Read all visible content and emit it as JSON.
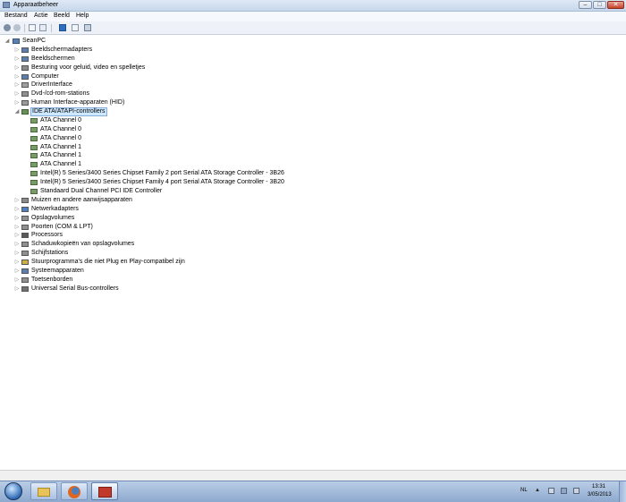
{
  "window": {
    "title": "Apparaatbeheer",
    "minimize": "–",
    "maximize": "□",
    "close": "✕"
  },
  "menu": [
    "Bestand",
    "Actie",
    "Beeld",
    "Help"
  ],
  "toolbar": {
    "icons": [
      "back-icon",
      "forward-icon",
      "properties-icon",
      "show-hide-tree-icon",
      "help-icon",
      "view-icon",
      "scan-hardware-icon"
    ]
  },
  "tree": {
    "root": "SeanPC",
    "categories_before": [
      {
        "label": "Beeldschermadapters",
        "icon": "display-adapter-icon",
        "color": "#5a7fb0"
      },
      {
        "label": "Beeldschermen",
        "icon": "monitor-icon",
        "color": "#5a7fb0"
      },
      {
        "label": "Besturing voor geluid, video en spelletjes",
        "icon": "speaker-icon",
        "color": "#8a8a8a"
      },
      {
        "label": "Computer",
        "icon": "computer-icon",
        "color": "#5a7fb0"
      },
      {
        "label": "DriverInterface",
        "icon": "driver-interface-icon",
        "color": "#a0a0a0"
      },
      {
        "label": "Dvd-/cd-rom-stations",
        "icon": "dvd-drive-icon",
        "color": "#909090"
      },
      {
        "label": "Human Interface-apparaten (HID)",
        "icon": "hid-icon",
        "color": "#9a9a9a"
      }
    ],
    "expanded": {
      "label": "IDE ATA/ATAPI-controllers",
      "icon": "ide-controller-icon",
      "color": "#6a8f5a"
    },
    "children": [
      "ATA Channel 0",
      "ATA Channel 0",
      "ATA Channel 0",
      "ATA Channel 1",
      "ATA Channel 1",
      "ATA Channel 1",
      "Intel(R) 5 Series/3400 Series Chipset Family 2 port Serial ATA Storage Controller - 3B26",
      "Intel(R) 5 Series/3400 Series Chipset Family 4 port Serial ATA Storage Controller - 3B20",
      "Standaard Dual Channel PCI IDE Controller"
    ],
    "categories_after": [
      {
        "label": "Muizen en andere aanwijsapparaten",
        "icon": "mouse-icon",
        "color": "#8a8a8a"
      },
      {
        "label": "Netwerkadapters",
        "icon": "network-adapter-icon",
        "color": "#4a7fc0"
      },
      {
        "label": "Opslagvolumes",
        "icon": "storage-volume-icon",
        "color": "#909090"
      },
      {
        "label": "Poorten (COM & LPT)",
        "icon": "port-icon",
        "color": "#909090"
      },
      {
        "label": "Processors",
        "icon": "processor-icon",
        "color": "#5a5a5a"
      },
      {
        "label": "Schaduwkopieën van opslagvolumes",
        "icon": "shadow-copy-icon",
        "color": "#909090"
      },
      {
        "label": "Schijfstations",
        "icon": "disk-drive-icon",
        "color": "#909090"
      },
      {
        "label": "Stuurprogramma's die niet Plug en Play-compatibel zijn",
        "icon": "non-pnp-driver-icon",
        "color": "#d0b040"
      },
      {
        "label": "Systeemapparaten",
        "icon": "system-device-icon",
        "color": "#5a7fb0"
      },
      {
        "label": "Toetsenborden",
        "icon": "keyboard-icon",
        "color": "#909090"
      },
      {
        "label": "Universal Serial Bus-controllers",
        "icon": "usb-controller-icon",
        "color": "#707070"
      }
    ]
  },
  "taskbar": {
    "language": "NL",
    "tray_chevron": "▲",
    "time": "13:31",
    "date": "3/05/2013",
    "pinned": [
      {
        "name": "windows-explorer-icon",
        "color": "#e8c35a"
      },
      {
        "name": "firefox-icon",
        "color": "#e0661f"
      },
      {
        "name": "device-manager-icon",
        "color": "#c0392b"
      }
    ]
  }
}
